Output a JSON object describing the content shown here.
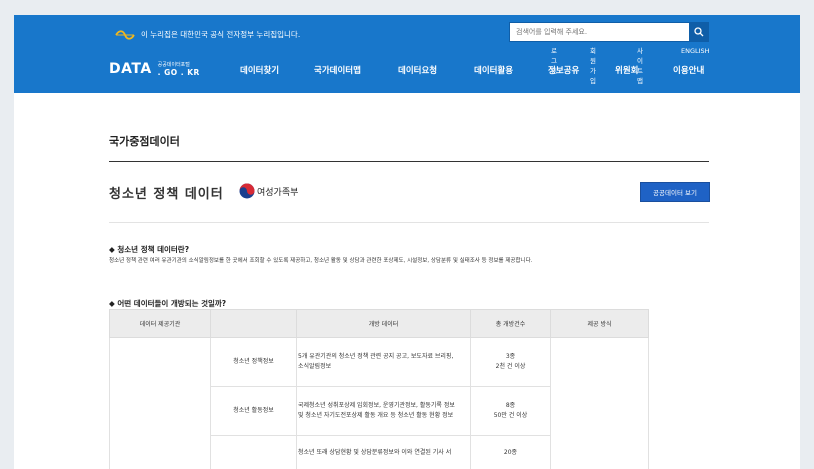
{
  "header": {
    "gov_notice": "이 누리집은 대한민국 공식 전자정부 누리집입니다.",
    "search_placeholder": "검색어를 입력해 주세요.",
    "util_links": [
      "로그인",
      "회원가입",
      "사이트맵",
      "ENGLISH"
    ],
    "logo": {
      "big": "DATA",
      "small_top": "공공데이터포털",
      "small_bottom": ". GO . KR"
    },
    "nav": [
      "데이터찾기",
      "국가데이터맵",
      "데이터요청",
      "데이터활용",
      "정보공유",
      "위원회",
      "이용안내"
    ],
    "bg_color": "#1877cb"
  },
  "page": {
    "title": "국가중점데이터",
    "sub_title": "청소년 정책 데이터",
    "ministry": "여성가족부",
    "view_button": "공공데이터 보기",
    "q1_title": "◆ 청소년 정책 데이터란?",
    "q1_desc": "청소년 정책 관련 여러 유관기관의 소식알림정보를 한 곳에서 조회할 수 있도록 제공하고, 청소년 활동 및 상담과 관련한 포상제도, 시설정보, 상담분류 및 실태조사 등 정보를 제공합니다.",
    "q2_title": "◆ 어떤 데이터들이 개방되는 것일까?"
  },
  "table": {
    "headers": [
      "데이터 제공기관",
      "",
      "개방 데이터",
      "총 개방건수",
      "제공 방식"
    ],
    "rows": [
      {
        "category": "청소년 정책정보",
        "desc1": "5개 유관기관의 청소년 정책 관련 공지 공고, 보도자료 브리핑,",
        "desc2": "소식알림정보",
        "count1": "3종",
        "count2": "2천 건 이상"
      },
      {
        "category": "청소년 활동정보",
        "desc1": "국제청소년 성취포상제 입회정보, 운영기관정보, 활동기록 정보",
        "desc2": "및 청소년 자기도전포상제 활동 개요 등 청소년 활동 현황 정보",
        "count1": "8종",
        "count2": "50만 건 이상"
      },
      {
        "category": "",
        "desc1": "청소년 또래 상담현황 및 상담분류정보와 이와 연결된 기사 서",
        "desc2": "",
        "count1": "20종",
        "count2": ""
      }
    ]
  }
}
